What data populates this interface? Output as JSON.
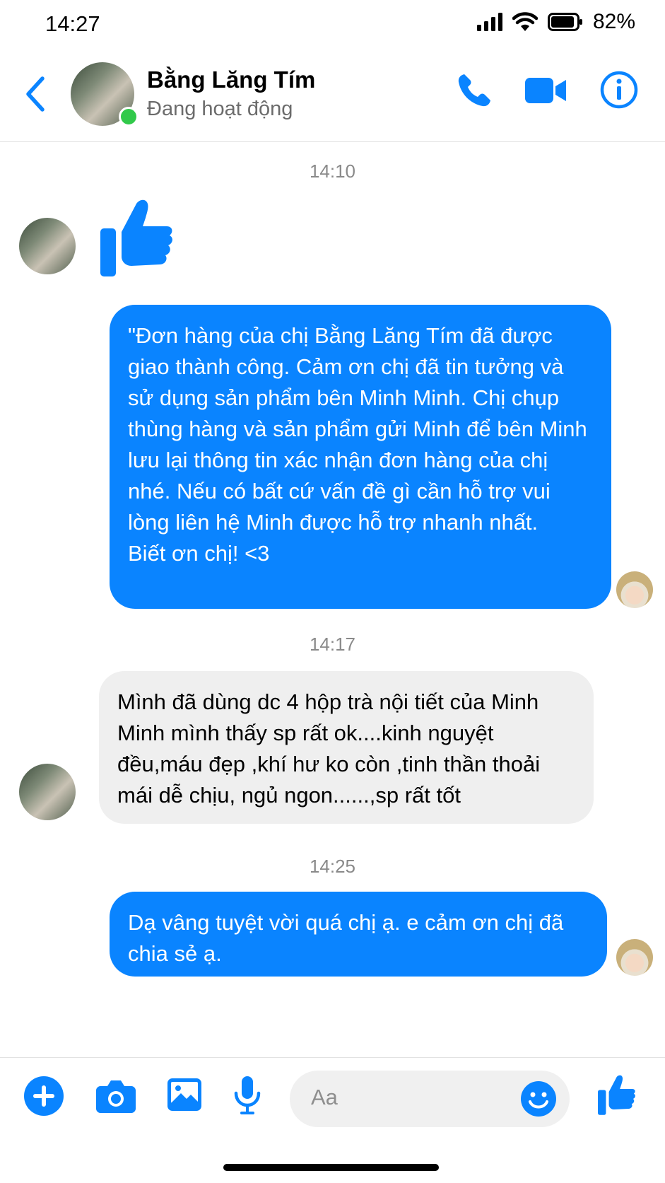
{
  "status_bar": {
    "time": "14:27",
    "battery": "82%"
  },
  "header": {
    "contact_name": "Bằng Lăng Tím",
    "status": "Đang hoạt động"
  },
  "messages": [
    {
      "timestamp": "14:10"
    },
    {
      "text": "\"Đơn hàng của chị Bằng Lăng Tím đã được giao thành công. Cảm ơn chị đã tin tưởng và sử dụng sản phẩm bên Minh Minh. Chị chụp thùng hàng và sản phẩm gửi Minh để bên Minh lưu lại thông tin xác nhận đơn hàng của chị nhé. Nếu có bất cứ vấn đề gì cần hỗ trợ vui lòng liên hệ  Minh được hỗ trợ nhanh nhất.\nBiết ơn chị! <3"
    },
    {
      "timestamp": "14:17"
    },
    {
      "text": "Mình đã dùng dc 4 hộp trà nội tiết của Minh Minh mình thấy sp rất ok....kinh nguyệt đều,máu đẹp ,khí hư ko còn ,tinh thần thoải mái dễ chịu, ngủ ngon......,sp rất tốt"
    },
    {
      "timestamp": "14:25"
    },
    {
      "text": "Dạ vâng tuyệt vời quá chị ạ. e cảm ơn chị đã chia sẻ ạ."
    }
  ],
  "composer": {
    "placeholder": "Aa"
  },
  "colors": {
    "accent": "#0a84ff",
    "incoming_bubble": "#efefef",
    "online": "#31c94a"
  }
}
